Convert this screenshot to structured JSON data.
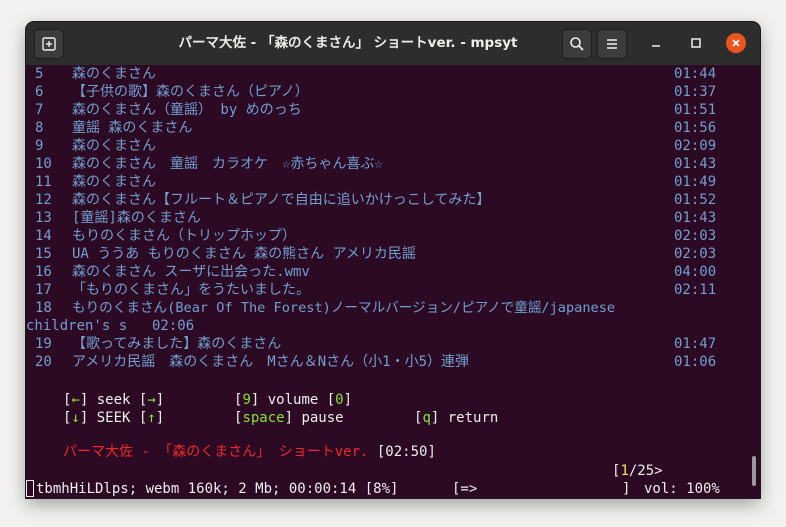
{
  "window": {
    "title": "パーマ大佐 - 「森のくまさん」 ショートver. - mpsyt"
  },
  "playlist": [
    {
      "num": "5",
      "title": "森のくまさん",
      "duration": "01:44"
    },
    {
      "num": "6",
      "title": "【子供の歌】森のくまさん（ピアノ）",
      "duration": "01:37"
    },
    {
      "num": "7",
      "title": "森のくまさん（童謡） by めのっち",
      "duration": "01:51"
    },
    {
      "num": "8",
      "title": "童謡 森のくまさん",
      "duration": "01:56"
    },
    {
      "num": "9",
      "title": "森のくまさん",
      "duration": "02:09"
    },
    {
      "num": "10",
      "title": "森のくまさん　童謡　カラオケ　☆赤ちゃん喜ぶ☆",
      "duration": "01:43"
    },
    {
      "num": "11",
      "title": "森のくまさん",
      "duration": "01:49"
    },
    {
      "num": "12",
      "title": "森のくまさん【フルート＆ピアノで自由に追いかけっこしてみた】",
      "duration": "01:52"
    },
    {
      "num": "13",
      "title": "[童謡]森のくまさん",
      "duration": "01:43"
    },
    {
      "num": "14",
      "title": "もりのくまさん（トリップホップ）",
      "duration": "02:03"
    },
    {
      "num": "15",
      "title": "UA ううあ もりのくまさん 森の熊さん アメリカ民謡",
      "duration": "02:03"
    },
    {
      "num": "16",
      "title": "森のくまさん スーザに出会った.wmv",
      "duration": "04:00"
    },
    {
      "num": "17",
      "title": "「もりのくまさん」をうたいました。",
      "duration": "02:11"
    },
    {
      "num": "18",
      "title": "もりのくまさん(Bear Of The Forest)ノーマルバージョン/ピアノで童謡/japanese",
      "title_cont": "children's s",
      "duration": "02:06"
    },
    {
      "num": "19",
      "title": "【歌ってみました】森のくまさん",
      "duration": "01:47"
    },
    {
      "num": "20",
      "title": "アメリカ民謡　森のくまさん　Mさん＆Nさん（小1・小5）連弾",
      "duration": "01:06"
    }
  ],
  "controls": {
    "left_arrow": "←",
    "right_arrow": "→",
    "down_arrow": "↓",
    "up_arrow": "↑",
    "seek": "seek",
    "SEEK": "SEEK",
    "volume_down_key": "9",
    "volume_up_key": "0",
    "volume": "volume",
    "space_key": "space",
    "pause": "pause",
    "return_key": "q",
    "return": "return"
  },
  "now_playing": {
    "title": "パーマ大佐 - 「森のくまさん」 ショートver.",
    "duration": "[02:50]"
  },
  "queue": {
    "current": "1",
    "total": "/25>"
  },
  "status": {
    "info": "tbmhHiLDlps; webm 160k; 2 Mb; 00:00:14 [8%]",
    "progress": "[=>",
    "progress_end": "]",
    "volume": "vol: 100%"
  },
  "colors": {
    "terminal_bg": "#2c0a24",
    "list_text": "#729fcf",
    "key_green": "#8ae234",
    "key_yellow": "#fce94f",
    "now_playing_red": "#ef2929",
    "close_button": "#e95420"
  }
}
